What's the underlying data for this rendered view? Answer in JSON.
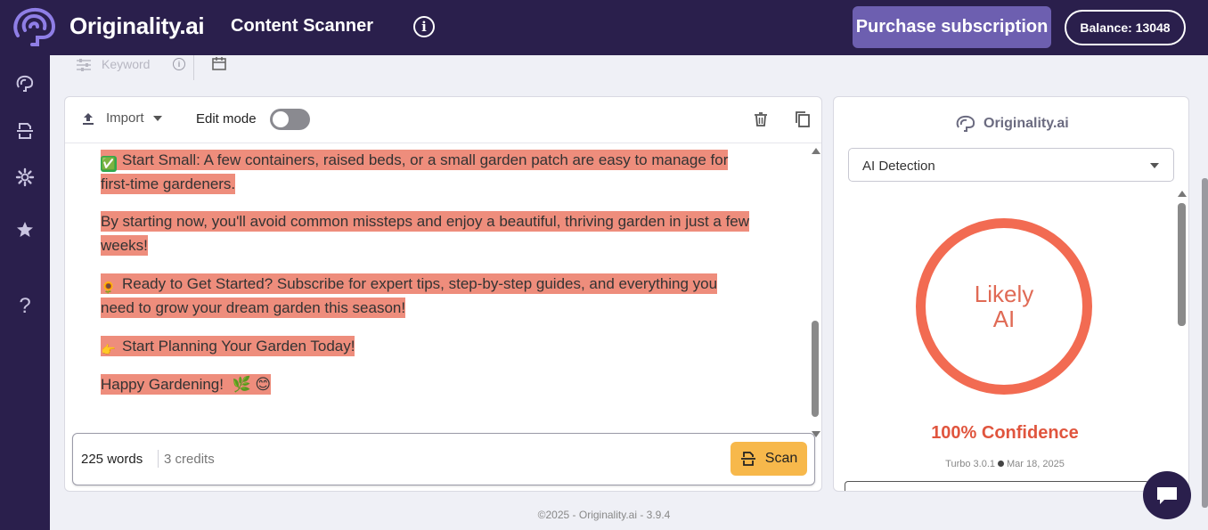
{
  "header": {
    "brand": "Originality.ai",
    "title": "Content Scanner",
    "info_symbol": "i",
    "purchase_label": "Purchase subscription",
    "balance_label": "Balance: 13048"
  },
  "subtoolbar": {
    "keyword_label": "Keyword",
    "info_symbol": "i"
  },
  "editor": {
    "import_label": "Import",
    "edit_mode_label": "Edit mode",
    "paragraphs": [
      {
        "emoji": "✅",
        "line1": "Start Small: A few containers, raised beds, or a small garden patch are easy to manage for",
        "line2": "first-time gardeners."
      },
      {
        "line1": "By starting now, you'll avoid common missteps and enjoy a beautiful, thriving garden in just a few",
        "line2": "weeks!"
      },
      {
        "emoji": "🌻",
        "line1": "Ready to Get Started?  Subscribe for expert tips, step-by-step guides, and everything you",
        "line2": "need to grow your dream garden this season!"
      },
      {
        "emoji": "👉",
        "line1": "Start Planning Your Garden Today!"
      },
      {
        "line1": "Happy Gardening!",
        "emoji_end": "🌿 😊"
      }
    ],
    "words": "225 words",
    "credits": "3 credits",
    "scan_label": "Scan"
  },
  "results": {
    "brand": "Originality.ai",
    "select_value": "AI Detection",
    "ring_line1": "Likely",
    "ring_line2": "AI",
    "confidence": "100% Confidence",
    "model": "Turbo 3.0.1",
    "date": "Mar 18, 2025"
  },
  "sidebar": {
    "help_symbol": "?"
  },
  "footer": {
    "copyright": "©2025 - Originality.ai - 3.9.4"
  },
  "colors": {
    "nav_bg": "#2a1f4c",
    "highlight": "#ee8d7c",
    "ring": "#f26b52",
    "scan_button": "#f7b84b",
    "purchase_button": "#6d5fb0"
  }
}
